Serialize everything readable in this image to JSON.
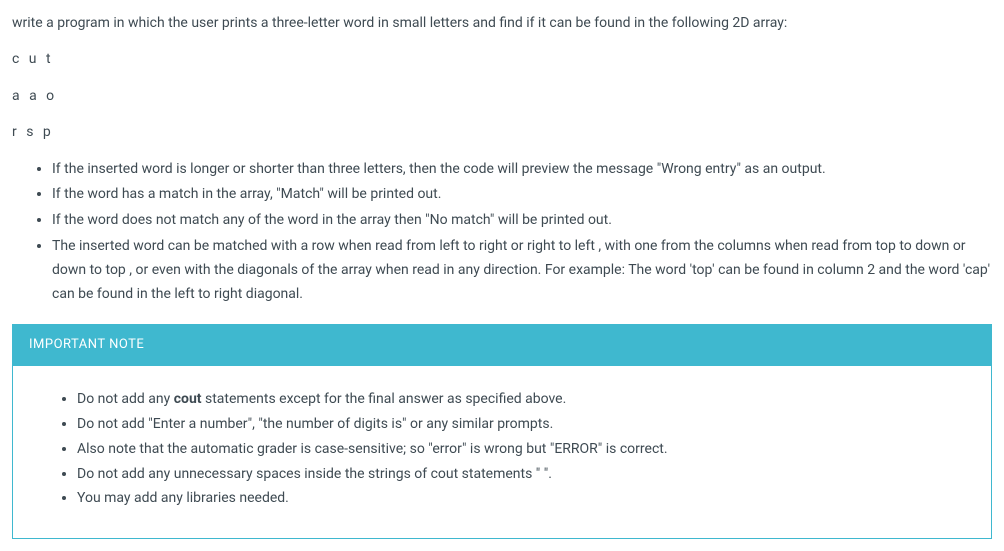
{
  "intro": "write a program in which the user prints a three-letter word in small letters and find if it can be found in the following 2D array:",
  "array": {
    "row1": "c u t",
    "row2": "a a o",
    "row3": "r s p"
  },
  "rules": [
    "If the inserted word is longer or shorter than three letters, then the code will preview the message \"Wrong entry\" as an output.",
    "If the word has a match in the array, \"Match\" will be printed out.",
    "If the word does not match any of the word in the array then \"No match\" will be printed out.",
    "The inserted word can be matched with a row when read from left to right or right to left , with one from the columns when read from top to down or down to top , or even with the diagonals of the array when read in any direction. For example: The word 'top' can be found in column 2 and the word 'cap' can be found in the left to right diagonal."
  ],
  "note": {
    "header": "IMPORTANT NOTE",
    "items_pre": [
      "Do not add any "
    ],
    "item0_bold": "cout",
    "item0_post": " statements except for the final answer as specified above.",
    "items_rest": [
      "Do not add \"Enter a number\", \"the number of digits is\" or any similar prompts.",
      "Also note that the automatic grader is case-sensitive; so \"error\" is wrong but \"ERROR\" is correct.",
      "Do not add any unnecessary spaces inside the strings of cout statements \" \".",
      "You may add any libraries needed."
    ]
  }
}
